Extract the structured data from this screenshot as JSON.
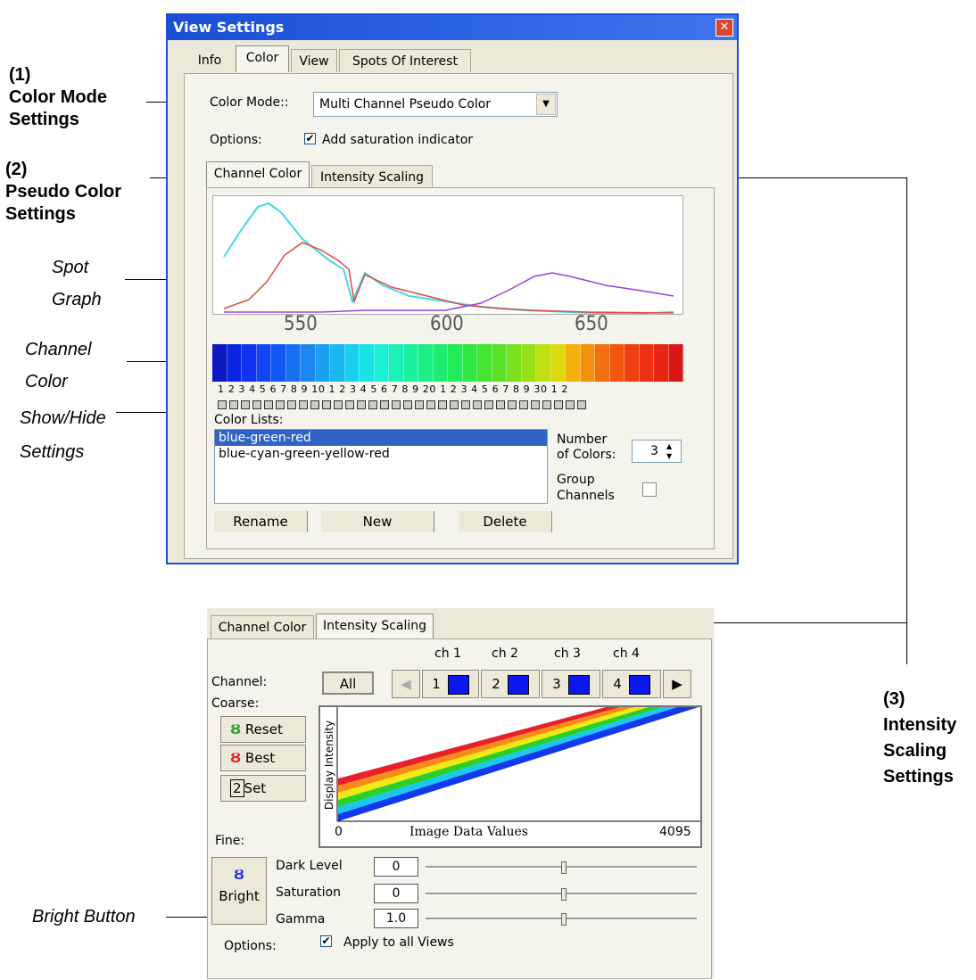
{
  "annotations": {
    "color_mode": {
      "num": "(1)",
      "line1": "Color Mode",
      "line2": "Settings"
    },
    "pseudo_color": {
      "num": "(2)",
      "line1": "Pseudo Color",
      "line2": "Settings"
    },
    "spot_graph": {
      "line1": "Spot",
      "line2": "Graph"
    },
    "channel_color": {
      "line1": "Channel",
      "line2": "Color"
    },
    "show_hide": {
      "line1": "Show/Hide",
      "line2": "Settings"
    },
    "intensity": {
      "num": "(3)",
      "line1": "Intensity",
      "line2": "Scaling",
      "line3": "Settings"
    },
    "bright_button": "Bright Button"
  },
  "window": {
    "title": "View Settings",
    "close_glyph": "✕",
    "tabs": [
      {
        "label": "Info",
        "active": false
      },
      {
        "label": "Color",
        "active": true
      },
      {
        "label": "View",
        "active": false
      },
      {
        "label": "Spots Of Interest",
        "active": false
      }
    ],
    "color_mode_label": "Color Mode::",
    "color_mode_value": "Multi Channel Pseudo Color",
    "options_label": "Options:",
    "saturation_label": "Add saturation indicator",
    "saturation_checked": true,
    "subtabs": [
      {
        "label": "Channel Color",
        "active": true
      },
      {
        "label": "Intensity Scaling",
        "active": false
      }
    ],
    "spot_graph": {
      "x_ticks": [
        "550",
        "600",
        "650"
      ]
    },
    "channel_numbers": "1 2 3 4 5 6 7 8 9 10 1 2 3 4 5 6 7 8 9 20 1 2 3 4 5 6 7 8 9 30 1 2",
    "color_lists_label": "Color Lists:",
    "color_lists": [
      "blue-green-red",
      "blue-cyan-green-yellow-red"
    ],
    "selected_list": 0,
    "number_of_colors_label1": "Number",
    "number_of_colors_label2": "of Colors:",
    "number_of_colors": "3",
    "group_channels_label1": "Group",
    "group_channels_label2": "Channels",
    "buttons": {
      "rename": "Rename",
      "new": "New",
      "delete": "Delete"
    }
  },
  "intensity_panel": {
    "subtabs": [
      {
        "label": "Channel Color",
        "active": false
      },
      {
        "label": "Intensity Scaling",
        "active": true
      }
    ],
    "channel_label": "Channel:",
    "all_button": "All",
    "channels": [
      {
        "header": "ch 1",
        "num": "1"
      },
      {
        "header": "ch 2",
        "num": "2"
      },
      {
        "header": "ch 3",
        "num": "3"
      },
      {
        "header": "ch 4",
        "num": "4"
      }
    ],
    "coarse_label": "Coarse:",
    "reset_label": "Reset",
    "best_label": "Best",
    "set_label": "Set",
    "set_num": "2",
    "y_axis_label": "Display Intensity",
    "x_axis_label": "Image Data Values",
    "x_min": "0",
    "x_max": "4095",
    "fine_label": "Fine:",
    "bright_label": "Bright",
    "fine_rows": [
      {
        "label": "Dark Level",
        "value": "0"
      },
      {
        "label": "Saturation",
        "value": "0"
      },
      {
        "label": "Gamma",
        "value": "1.0"
      }
    ],
    "options_label": "Options:",
    "apply_label": "Apply to all Views",
    "apply_checked": true
  }
}
